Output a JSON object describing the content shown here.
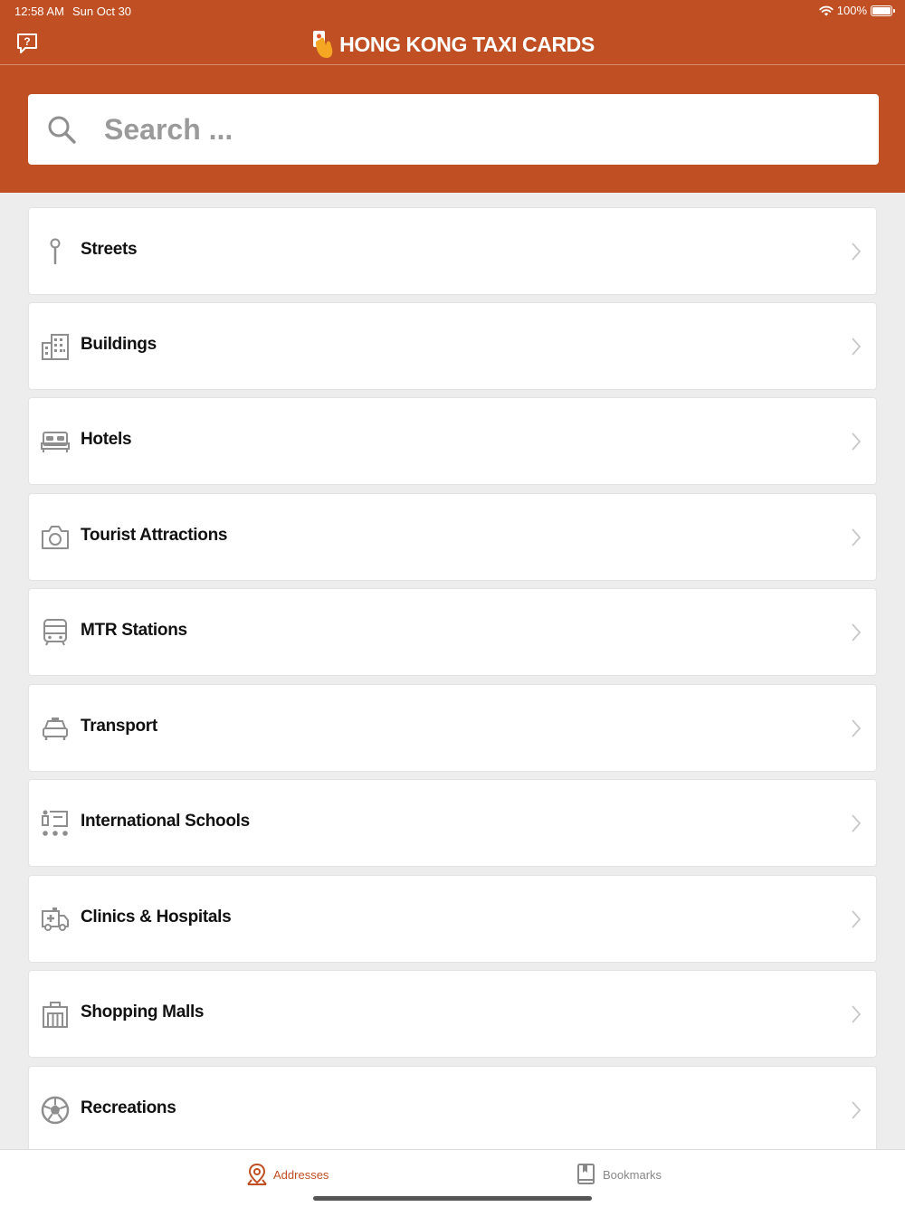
{
  "status_bar": {
    "time": "12:58 AM",
    "date": "Sun Oct 30",
    "battery": "100%"
  },
  "header": {
    "title": "HONG KONG TAXI CARDS"
  },
  "search": {
    "placeholder": "Search ..."
  },
  "categories": [
    {
      "label": "Streets",
      "icon": "pin-icon"
    },
    {
      "label": "Buildings",
      "icon": "buildings-icon"
    },
    {
      "label": "Hotels",
      "icon": "bed-icon"
    },
    {
      "label": "Tourist Attractions",
      "icon": "camera-icon"
    },
    {
      "label": "MTR Stations",
      "icon": "train-icon"
    },
    {
      "label": "Transport",
      "icon": "taxi-icon"
    },
    {
      "label": "International Schools",
      "icon": "school-icon"
    },
    {
      "label": "Clinics & Hospitals",
      "icon": "ambulance-icon"
    },
    {
      "label": "Shopping Malls",
      "icon": "mall-icon"
    },
    {
      "label": "Recreations",
      "icon": "ball-icon"
    }
  ],
  "tabs": {
    "addresses": "Addresses",
    "bookmarks": "Bookmarks"
  },
  "colors": {
    "brand": "#c04f23",
    "icon_gray": "#8e8e8e"
  }
}
